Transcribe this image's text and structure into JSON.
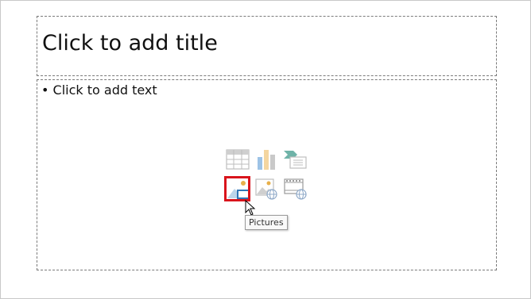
{
  "slide": {
    "title_placeholder": "Click to add title",
    "body_placeholder": "• Click to add text"
  },
  "content_icons": {
    "items": [
      {
        "name": "insert-table-icon",
        "tooltip": ""
      },
      {
        "name": "insert-chart-icon",
        "tooltip": ""
      },
      {
        "name": "insert-smartart-icon",
        "tooltip": ""
      },
      {
        "name": "pictures-icon",
        "tooltip": "Pictures",
        "highlighted": true
      },
      {
        "name": "online-pictures-icon",
        "tooltip": ""
      },
      {
        "name": "insert-video-icon",
        "tooltip": ""
      }
    ],
    "tooltip_text": "Pictures"
  },
  "colors": {
    "highlight": "#d9141c",
    "icon_gray": "#c9c9c9",
    "icon_blue": "#2e75b6",
    "icon_gold": "#e8b04a",
    "icon_teal": "#5aa29a"
  }
}
